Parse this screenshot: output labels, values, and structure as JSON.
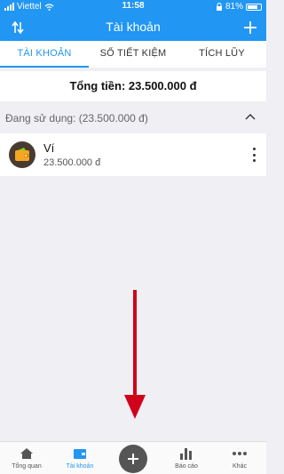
{
  "status_bar": {
    "carrier": "Viettel",
    "time": "11:58",
    "battery": "81%",
    "battery_level": 0.81
  },
  "header": {
    "title": "Tài khoản"
  },
  "tabs": [
    {
      "label": "TÀI KHOẢN",
      "active": true
    },
    {
      "label": "SỔ TIẾT KIỆM",
      "active": false
    },
    {
      "label": "TÍCH LŨY",
      "active": false
    }
  ],
  "total": {
    "text": "Tổng tiền: 23.500.000 đ"
  },
  "group": {
    "label": "Đang sử dụng: (23.500.000 đ)"
  },
  "wallets": [
    {
      "name": "Ví",
      "amount": "23.500.000 đ",
      "icon": "wallet-icon"
    }
  ],
  "bottom_nav": [
    {
      "label": "Tổng quan",
      "icon": "home-icon",
      "active": false
    },
    {
      "label": "Tài khoản",
      "icon": "wallet-card-icon",
      "active": true
    },
    {
      "label": "Báo cáo",
      "icon": "bar-chart-icon",
      "active": false
    },
    {
      "label": "Khác",
      "icon": "more-dots-icon",
      "active": false
    }
  ],
  "colors": {
    "primary": "#2196f3",
    "annotation_arrow": "#d0021b"
  }
}
